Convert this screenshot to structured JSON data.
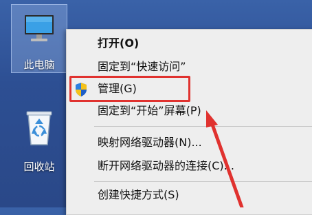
{
  "desktop": {
    "icons": [
      {
        "label": "此电脑"
      },
      {
        "label": "回收站"
      }
    ]
  },
  "context_menu": {
    "items": [
      {
        "label": "打开(O)"
      },
      {
        "label": "固定到“快速访问”"
      },
      {
        "label": "管理(G)"
      },
      {
        "label": "固定到“开始”屏幕(P)"
      },
      {
        "label": "映射网络驱动器(N)..."
      },
      {
        "label": "断开网络驱动器的连接(C)..."
      },
      {
        "label": "创建快捷方式(S)"
      }
    ]
  },
  "annotation_color": "#e0322f"
}
